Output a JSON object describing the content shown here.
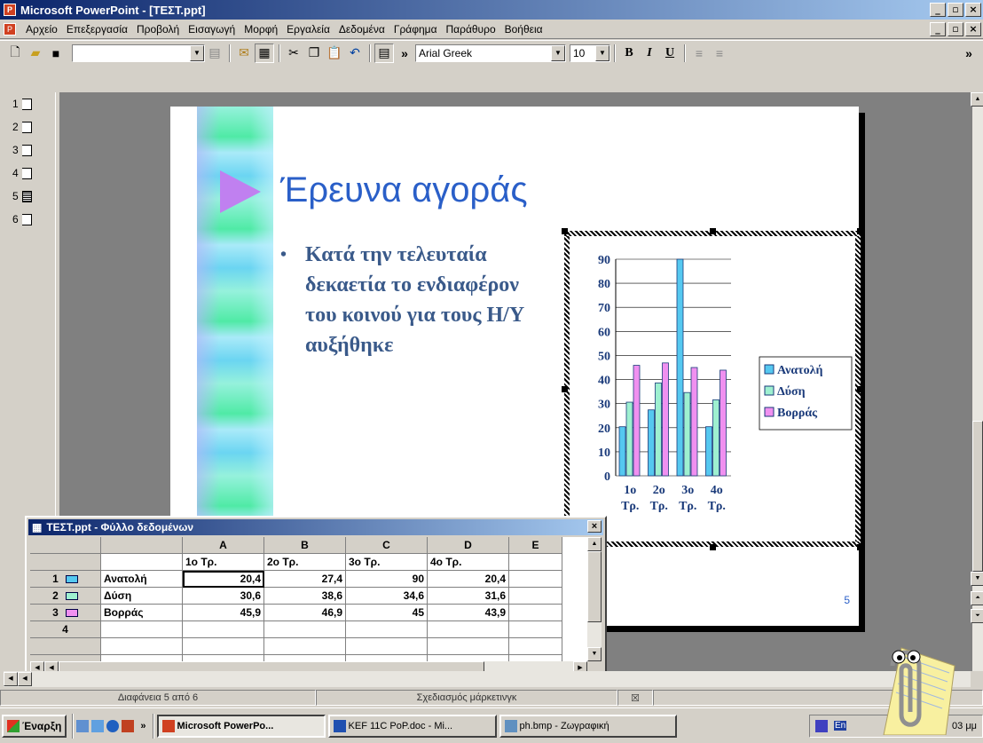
{
  "window": {
    "title": "Microsoft PowerPoint - [ΤΕΣΤ.ppt]"
  },
  "menu": [
    "Αρχείο",
    "Επεξεργασία",
    "Προβολή",
    "Εισαγωγή",
    "Μορφή",
    "Εργαλεία",
    "Δεδομένα",
    "Γράφημα",
    "Παράθυρο",
    "Βοήθεια"
  ],
  "toolbar": {
    "font": "Arial Greek",
    "size": "10",
    "bold": "B",
    "italic": "I",
    "underline": "U",
    "more": "»"
  },
  "outline": {
    "slides": [
      "1",
      "2",
      "3",
      "4",
      "5",
      "6"
    ]
  },
  "slide": {
    "title": "Έρευνα αγοράς",
    "bullet": "Κατά την τελευταία δεκαετία το ενδιαφέρον του κοινού για τους Η/Υ αυξήθηκε",
    "number": "5"
  },
  "chart_data": {
    "type": "bar",
    "categories": [
      "1ο Τρ.",
      "2ο Τρ.",
      "3ο Τρ.",
      "4ο Τρ."
    ],
    "series": [
      {
        "name": "Ανατολή",
        "values": [
          20.4,
          27.4,
          90,
          20.4
        ],
        "color": "#55c8f0"
      },
      {
        "name": "Δύση",
        "values": [
          30.6,
          38.6,
          34.6,
          31.6
        ],
        "color": "#9ef0d0"
      },
      {
        "name": "Βορράς",
        "values": [
          45.9,
          46.9,
          45,
          43.9
        ],
        "color": "#f090f0"
      }
    ],
    "ylim": [
      0,
      90
    ],
    "yticks": [
      "0",
      "10",
      "20",
      "30",
      "40",
      "50",
      "60",
      "70",
      "80",
      "90"
    ],
    "grid": true,
    "legend": "right"
  },
  "datasheet": {
    "title": "ΤΕΣΤ.ppt - Φύλλο δεδομένων",
    "columns": [
      "A",
      "B",
      "C",
      "D",
      "E"
    ],
    "headers": [
      "1ο Τρ.",
      "2ο Τρ.",
      "3ο Τρ.",
      "4ο Τρ.",
      ""
    ],
    "rows": [
      {
        "num": "1",
        "label": "Ανατολή",
        "cells": [
          "20,4",
          "27,4",
          "90",
          "20,4",
          ""
        ]
      },
      {
        "num": "2",
        "label": "Δύση",
        "cells": [
          "30,6",
          "38,6",
          "34,6",
          "31,6",
          ""
        ]
      },
      {
        "num": "3",
        "label": "Βορράς",
        "cells": [
          "45,9",
          "46,9",
          "45",
          "43,9",
          ""
        ]
      },
      {
        "num": "4",
        "label": "",
        "cells": [
          "",
          "",
          "",
          "",
          ""
        ]
      }
    ]
  },
  "status": {
    "slide": "Διαφάνεια 5 από 6",
    "design": "Σχεδιασμός μάρκετινγκ"
  },
  "taskbar": {
    "start": "Έναρξη",
    "more": "»",
    "tasks": [
      "Microsoft PowerPo...",
      "KEF 11C PoP.doc - Mi...",
      "ph.bmp - Ζωγραφική"
    ],
    "lang": "En",
    "clock": "03 μμ"
  }
}
